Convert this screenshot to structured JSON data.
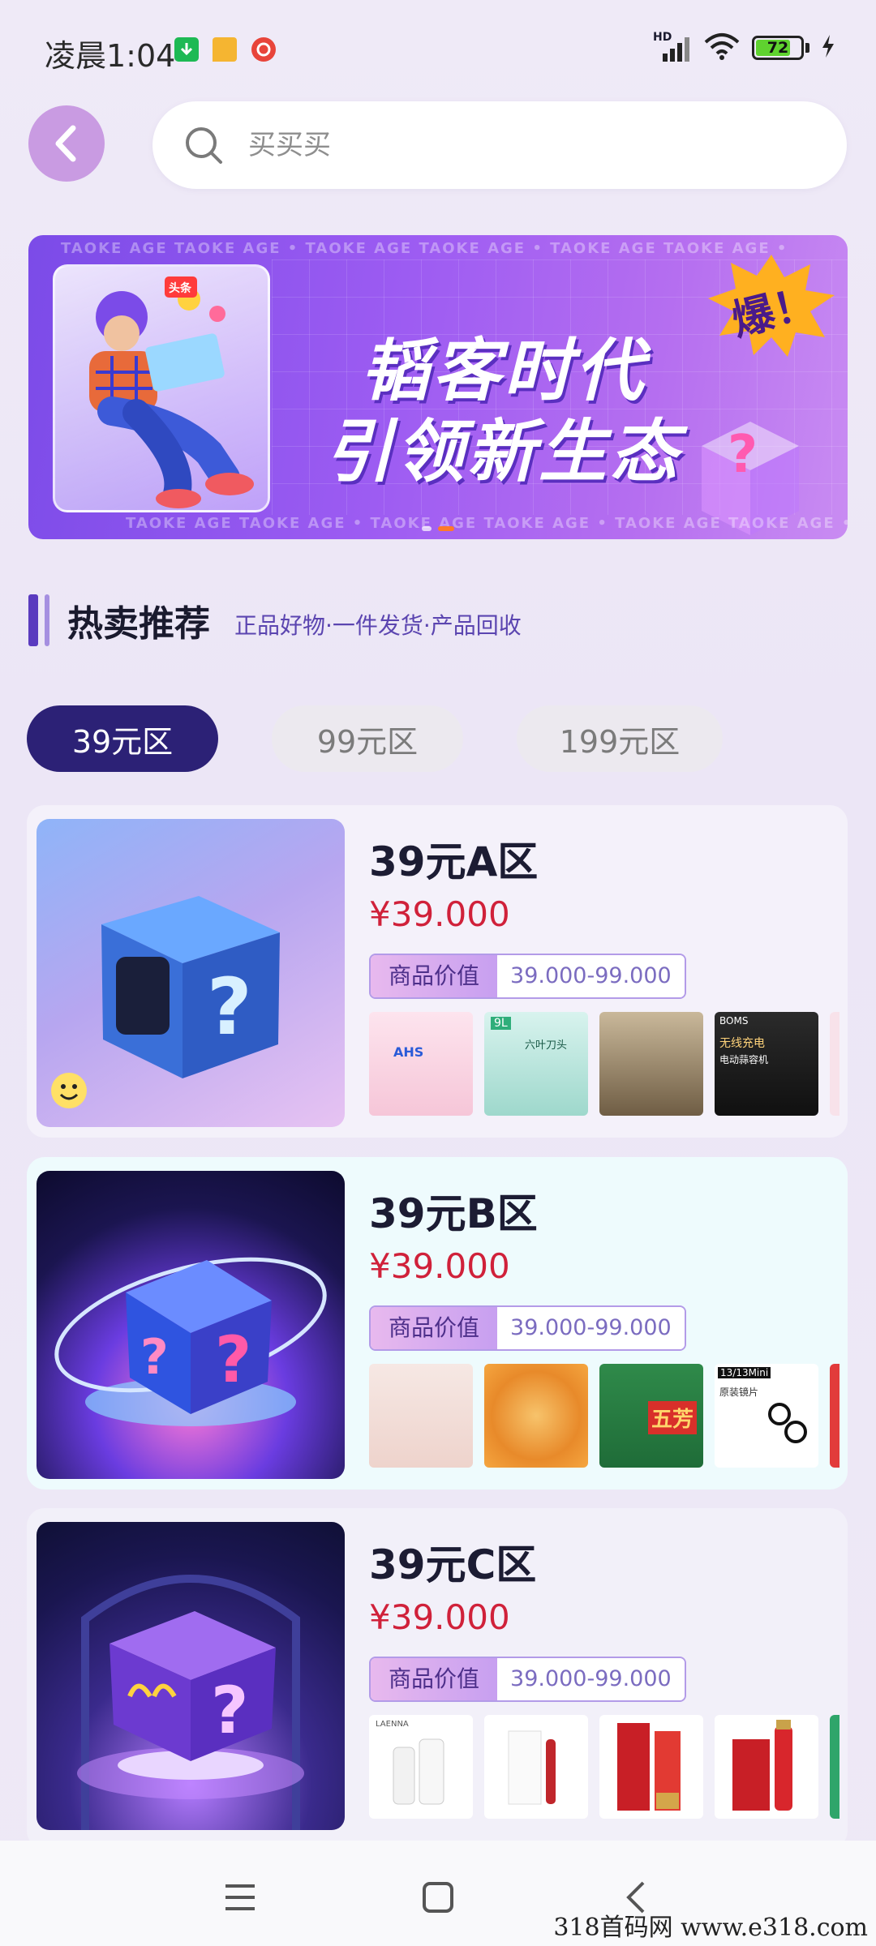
{
  "status_bar": {
    "time": "凌晨1:04",
    "network": "HD",
    "battery": "72",
    "battery_level": 0.72,
    "icons": [
      "download-icon",
      "message-icon",
      "music-icon",
      "signal-icon",
      "wifi-icon",
      "battery-icon",
      "charging-icon"
    ]
  },
  "search": {
    "placeholder": "买买买"
  },
  "banner": {
    "frame_text": "TAOKE AGE  TAOKE AGE  •  TAOKE AGE  TAOKE AGE  •  TAOKE AGE  TAOKE AGE  •",
    "line1": "韬客时代",
    "line2": "引领新生态",
    "badge": "爆！",
    "card_badge": "头条",
    "slide_count": 2,
    "active_slide": 2
  },
  "section": {
    "title": "热卖推荐",
    "subtitle": "正品好物·一件发货·产品回收"
  },
  "tabs": [
    {
      "label": "39元区",
      "active": true
    },
    {
      "label": "99元区",
      "active": false
    },
    {
      "label": "199元区",
      "active": false
    }
  ],
  "cards": [
    {
      "title": "39元A区",
      "price": "¥39.000",
      "value_label": "商品价值",
      "value_range": "39.000-99.000",
      "products": [
        "laundry-detergent",
        "meat-grinder",
        "glass-containers",
        "garlic-chopper",
        "partial-product"
      ],
      "product_texts": [
        "AHS",
        "9L",
        "六叶刀头",
        "BOMS",
        "无线充电",
        "电动蒜容机"
      ]
    },
    {
      "title": "39元B区",
      "price": "¥39.000",
      "value_label": "商品价值",
      "value_range": "39.000-99.000",
      "products": [
        "skincare-bottles",
        "spicy-snack",
        "zongzi-giftbox",
        "cosmetic-pads",
        "partial-product"
      ],
      "product_texts": [
        "五芳",
        "13/13Mini",
        "原装镜片"
      ]
    },
    {
      "title": "39元C区",
      "price": "¥39.000",
      "value_label": "商品价值",
      "value_range": "39.000-99.000",
      "products": [
        "cleanser-set",
        "serum-box",
        "red-tube",
        "red-essence",
        "partial-product"
      ],
      "product_texts": [
        "LAENNA"
      ]
    }
  ],
  "nav": {
    "buttons": [
      "menu-icon",
      "home-icon",
      "back-icon"
    ]
  },
  "watermark": "318首码网  www.e318.com",
  "colors": {
    "accent": "#2c2176",
    "price": "#d0213a",
    "back_button": "#c99be2"
  }
}
